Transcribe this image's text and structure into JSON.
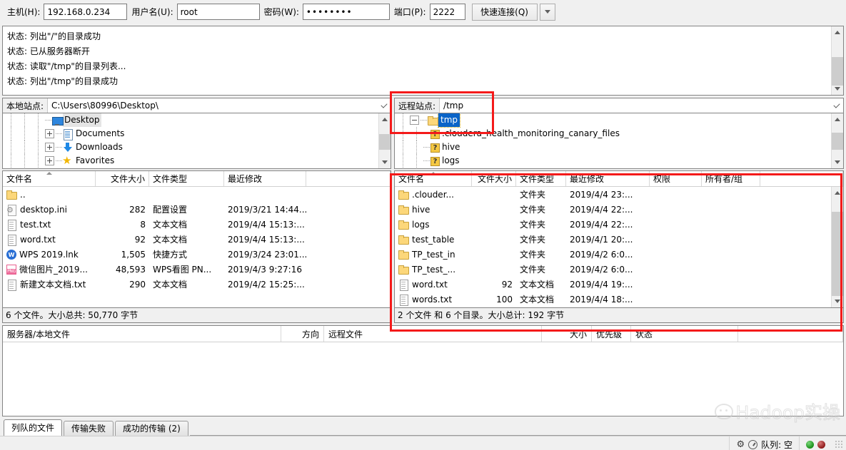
{
  "quick_connect": {
    "host_label": "主机(H):",
    "host_value": "192.168.0.234",
    "user_label": "用户名(U):",
    "user_value": "root",
    "pass_label": "密码(W):",
    "pass_value": "••••••••",
    "port_label": "端口(P):",
    "port_value": "2222",
    "connect_button": "快速连接(Q)"
  },
  "message_log": {
    "lines": [
      "状态: 列出\"/\"的目录成功",
      "状态: 已从服务器断开",
      "状态: 读取\"/tmp\"的目录列表...",
      "状态: 列出\"/tmp\"的目录成功"
    ]
  },
  "local": {
    "site_label": "本地站点:",
    "site_path": "C:\\Users\\80996\\Desktop\\",
    "tree": [
      {
        "label": "Desktop",
        "icon": "monitor-icon",
        "depth": 3,
        "expander": "none",
        "state": "softsel"
      },
      {
        "label": "Documents",
        "icon": "documents-icon",
        "depth": 3,
        "expander": "plus",
        "state": "normal"
      },
      {
        "label": "Downloads",
        "icon": "download-icon",
        "depth": 3,
        "expander": "plus",
        "state": "normal"
      },
      {
        "label": "Favorites",
        "icon": "star-icon",
        "depth": 3,
        "expander": "plus",
        "state": "normal"
      }
    ],
    "columns": [
      "文件名",
      "文件大小",
      "文件类型",
      "最近修改"
    ],
    "rows": [
      {
        "name": "..",
        "icon": "folder-icon",
        "size": "",
        "type": "",
        "modified": ""
      },
      {
        "name": "desktop.ini",
        "icon": "ini-icon",
        "size": "282",
        "type": "配置设置",
        "modified": "2019/3/21 14:44..."
      },
      {
        "name": "test.txt",
        "icon": "doc-icon",
        "size": "8",
        "type": "文本文档",
        "modified": "2019/4/4 15:13:..."
      },
      {
        "name": "word.txt",
        "icon": "doc-icon",
        "size": "92",
        "type": "文本文档",
        "modified": "2019/4/4 15:13:..."
      },
      {
        "name": "WPS 2019.lnk",
        "icon": "wps-icon",
        "size": "1,505",
        "type": "快捷方式",
        "modified": "2019/3/24 23:01..."
      },
      {
        "name": "微信图片_2019...",
        "icon": "png-icon",
        "size": "48,593",
        "type": "WPS看图 PN...",
        "modified": "2019/4/3 9:27:16"
      },
      {
        "name": "新建文本文档.txt",
        "icon": "doc-icon",
        "size": "290",
        "type": "文本文档",
        "modified": "2019/4/2 15:25:..."
      }
    ],
    "status": "6 个文件。大小总共: 50,770 字节"
  },
  "remote": {
    "site_label": "远程站点:",
    "site_path": "/tmp",
    "tree": [
      {
        "label": "tmp",
        "icon": "folder-icon",
        "depth": 1,
        "expander": "minus",
        "state": "selected"
      },
      {
        "label": ".cloudera_health_monitoring_canary_files",
        "icon": "qmark-icon",
        "depth": 2,
        "expander": "none",
        "state": "normal"
      },
      {
        "label": "hive",
        "icon": "qmark-icon",
        "depth": 2,
        "expander": "none",
        "state": "normal"
      },
      {
        "label": "logs",
        "icon": "qmark-icon",
        "depth": 2,
        "expander": "none",
        "state": "normal"
      }
    ],
    "columns": [
      "文件名",
      "文件大小",
      "文件类型",
      "最近修改",
      "权限",
      "所有者/组"
    ],
    "rows": [
      {
        "name": ".clouder...",
        "icon": "folder-icon",
        "size": "",
        "type": "文件夹",
        "modified": "2019/4/4 23:...",
        "perm": "",
        "owner": ""
      },
      {
        "name": "hive",
        "icon": "folder-icon",
        "size": "",
        "type": "文件夹",
        "modified": "2019/4/4 22:...",
        "perm": "",
        "owner": ""
      },
      {
        "name": "logs",
        "icon": "folder-icon",
        "size": "",
        "type": "文件夹",
        "modified": "2019/4/4 22:...",
        "perm": "",
        "owner": ""
      },
      {
        "name": "test_table",
        "icon": "folder-icon",
        "size": "",
        "type": "文件夹",
        "modified": "2019/4/1 20:...",
        "perm": "",
        "owner": ""
      },
      {
        "name": "TP_test_in",
        "icon": "folder-icon",
        "size": "",
        "type": "文件夹",
        "modified": "2019/4/2 6:0...",
        "perm": "",
        "owner": ""
      },
      {
        "name": "TP_test_...",
        "icon": "folder-icon",
        "size": "",
        "type": "文件夹",
        "modified": "2019/4/2 6:0...",
        "perm": "",
        "owner": ""
      },
      {
        "name": "word.txt",
        "icon": "doc-icon",
        "size": "92",
        "type": "文本文档",
        "modified": "2019/4/4 19:...",
        "perm": "",
        "owner": ""
      },
      {
        "name": "words.txt",
        "icon": "doc-icon",
        "size": "100",
        "type": "文本文档",
        "modified": "2019/4/4 18:...",
        "perm": "",
        "owner": ""
      }
    ],
    "status": "2 个文件 和 6 个目录。大小总计: 192 字节"
  },
  "queue": {
    "columns": [
      "服务器/本地文件",
      "方向",
      "远程文件",
      "大小",
      "优先级",
      "状态"
    ]
  },
  "tabs": [
    {
      "label": "列队的文件",
      "active": true
    },
    {
      "label": "传输失败",
      "active": false
    },
    {
      "label": "成功的传输 (2)",
      "active": false
    }
  ],
  "statusbar": {
    "queue_text": "队列: 空"
  },
  "watermark": {
    "text": "Hadoop实操"
  },
  "colors": {
    "annotation": "#f41a1a",
    "selection": "#0a64c8",
    "folder": "#fcd77a"
  }
}
